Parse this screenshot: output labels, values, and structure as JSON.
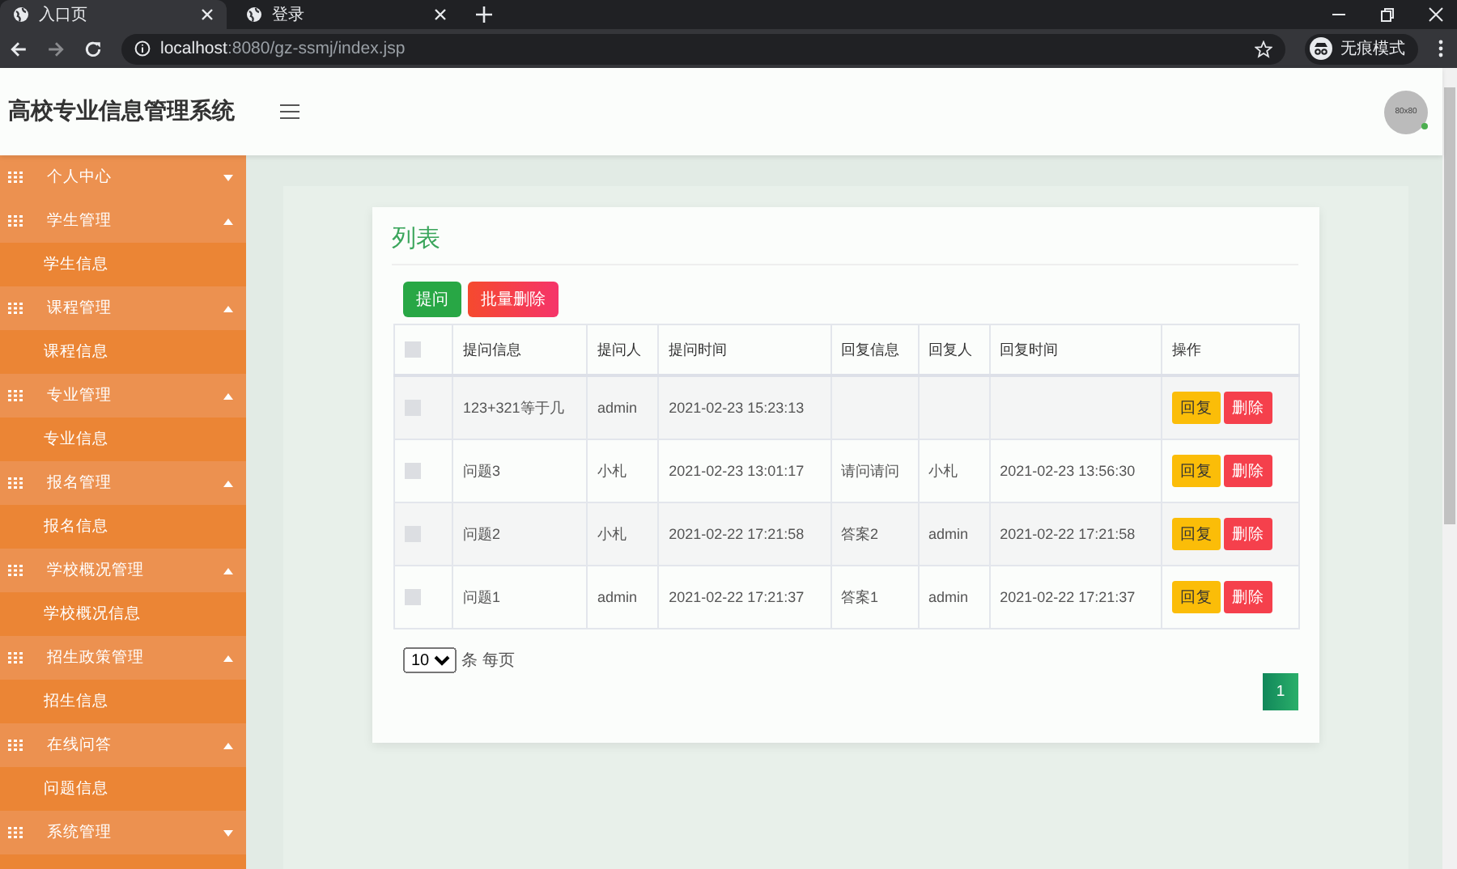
{
  "browser": {
    "tabs": [
      {
        "title": "入口页",
        "selected": true
      },
      {
        "title": "登录",
        "selected": false
      }
    ],
    "url_host": "localhost",
    "url_path": ":8080/gz-ssmj/index.jsp",
    "profile_label": "无痕模式"
  },
  "header": {
    "title": "高校专业信息管理系统",
    "avatar_text": "80x80"
  },
  "sidebar": {
    "items": [
      {
        "label": "个人中心",
        "expanded": false
      },
      {
        "label": "学生管理",
        "expanded": true,
        "children": [
          {
            "label": "学生信息"
          }
        ]
      },
      {
        "label": "课程管理",
        "expanded": true,
        "children": [
          {
            "label": "课程信息"
          }
        ]
      },
      {
        "label": "专业管理",
        "expanded": true,
        "children": [
          {
            "label": "专业信息"
          }
        ]
      },
      {
        "label": "报名管理",
        "expanded": true,
        "children": [
          {
            "label": "报名信息"
          }
        ]
      },
      {
        "label": "学校概况管理",
        "expanded": true,
        "children": [
          {
            "label": "学校概况信息"
          }
        ]
      },
      {
        "label": "招生政策管理",
        "expanded": true,
        "children": [
          {
            "label": "招生信息"
          }
        ]
      },
      {
        "label": "在线问答",
        "expanded": true,
        "children": [
          {
            "label": "问题信息"
          }
        ]
      },
      {
        "label": "系统管理",
        "expanded": false
      }
    ]
  },
  "panel": {
    "title": "列表",
    "buttons": [
      {
        "label": "提问",
        "kind": "add"
      },
      {
        "label": "批量删除",
        "kind": "batch-delete"
      }
    ],
    "table": {
      "select_all_checked": false,
      "columns": [
        "提问信息",
        "提问人",
        "提问时间",
        "回复信息",
        "回复人",
        "回复时间",
        "操作"
      ],
      "rows": [
        {
          "checked": false,
          "cells": [
            "123+321等于几",
            "admin",
            "2021-02-23 15:23:13",
            "",
            "",
            ""
          ],
          "actions": [
            {
              "label": "回复",
              "kind": "reply"
            },
            {
              "label": "删除",
              "kind": "delete"
            }
          ]
        },
        {
          "checked": false,
          "cells": [
            "问题3",
            "小札",
            "2021-02-23 13:01:17",
            "请问请问",
            "小札",
            "2021-02-23 13:56:30"
          ],
          "actions": [
            {
              "label": "回复",
              "kind": "reply"
            },
            {
              "label": "删除",
              "kind": "delete"
            }
          ]
        },
        {
          "checked": false,
          "cells": [
            "问题2",
            "小札",
            "2021-02-22 17:21:58",
            "答案2",
            "admin",
            "2021-02-22 17:21:58"
          ],
          "actions": [
            {
              "label": "回复",
              "kind": "reply"
            },
            {
              "label": "删除",
              "kind": "delete"
            }
          ]
        },
        {
          "checked": false,
          "cells": [
            "问题1",
            "admin",
            "2021-02-22 17:21:37",
            "答案1",
            "admin",
            "2021-02-22 17:21:37"
          ],
          "actions": [
            {
              "label": "回复",
              "kind": "reply"
            },
            {
              "label": "删除",
              "kind": "delete"
            }
          ]
        }
      ]
    },
    "pagination": {
      "page_size": "10",
      "per_page_label": "条 每页",
      "pages": [
        {
          "label": "1",
          "selected": true
        }
      ]
    }
  }
}
